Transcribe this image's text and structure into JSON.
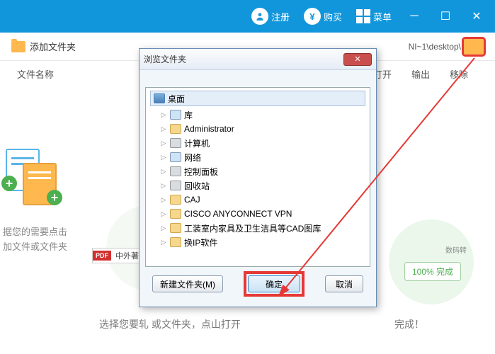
{
  "titlebar": {
    "register": "注册",
    "buy": "购买",
    "menu": "菜单"
  },
  "toolbar": {
    "add_folder": "添加文件夹",
    "path": "NI~1\\desktop\\"
  },
  "header": {
    "filename": "文件名称",
    "open": "打开",
    "export": "输出",
    "remove": "移除"
  },
  "dropzone": {
    "line1": "据您的需要点击",
    "line2": "加文件或文件夹"
  },
  "pdf_badge": "中外著名题",
  "download_label": "数码转",
  "done_badge": "100%  完成",
  "bottom_text": "选择您要轧\n或文件夹，点山打开",
  "bottom_done": "完成！",
  "dialog": {
    "title": "浏览文件夹",
    "desktop": "桌面",
    "items": [
      {
        "icon": "lib",
        "label": "库"
      },
      {
        "icon": "folder",
        "label": "Administrator"
      },
      {
        "icon": "pc",
        "label": "计算机"
      },
      {
        "icon": "net",
        "label": "网络"
      },
      {
        "icon": "ctrl",
        "label": "控制面板"
      },
      {
        "icon": "bin",
        "label": "回收站"
      },
      {
        "icon": "folder",
        "label": "CAJ"
      },
      {
        "icon": "folder",
        "label": "CISCO ANYCONNECT VPN"
      },
      {
        "icon": "folder",
        "label": "工装室内家具及卫生洁具等CAD图库"
      },
      {
        "icon": "folder",
        "label": "换IP软件"
      }
    ],
    "new_folder": "新建文件夹(M)",
    "ok": "确定",
    "cancel": "取消"
  }
}
